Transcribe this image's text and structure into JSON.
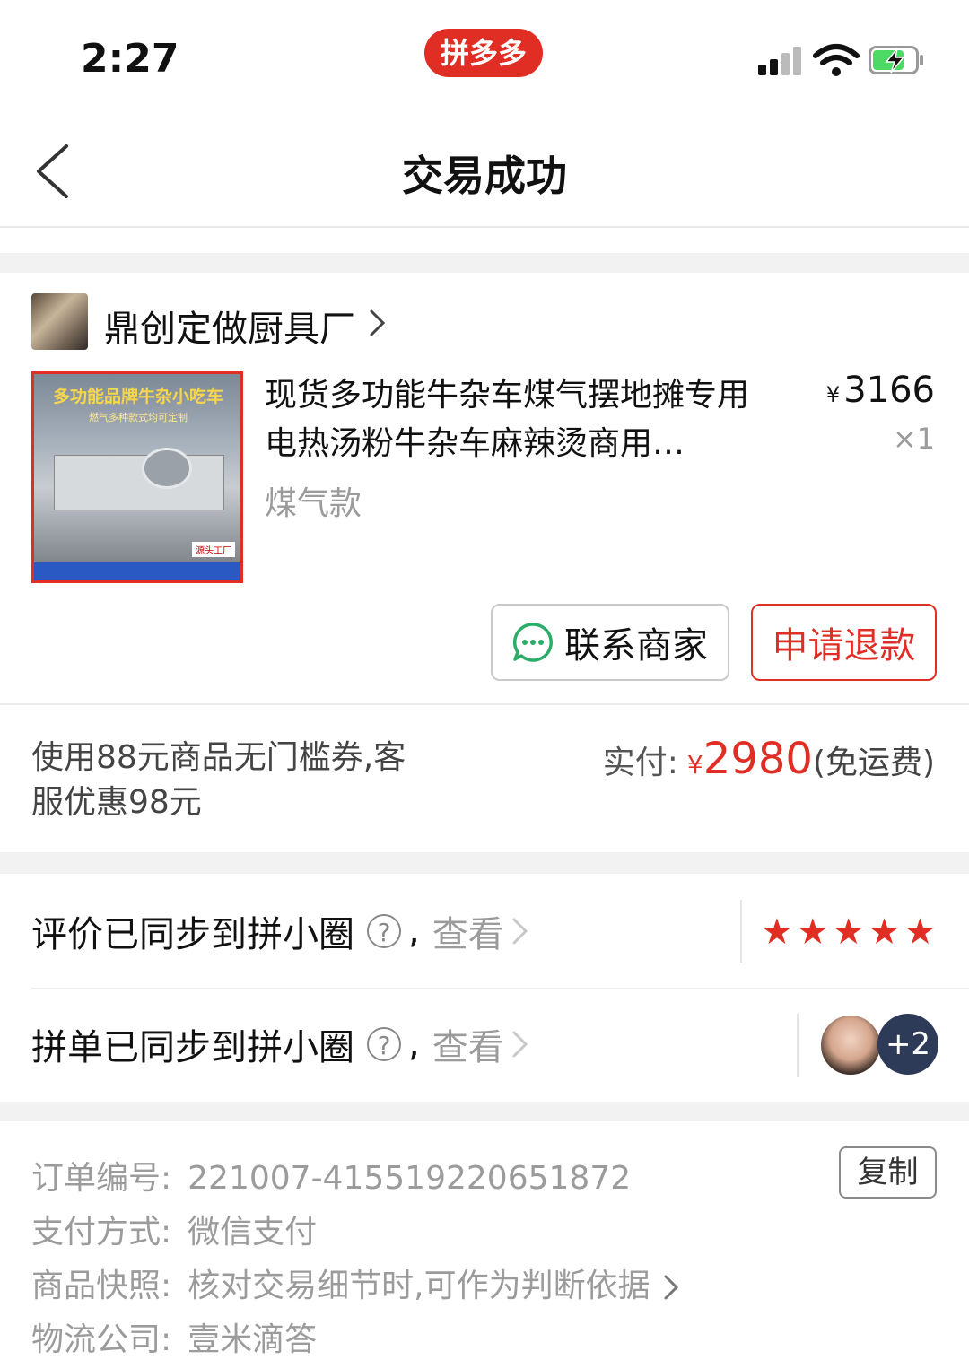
{
  "status_bar": {
    "time": "2:27",
    "app_badge": "拼多多"
  },
  "nav": {
    "title": "交易成功"
  },
  "store": {
    "name": "鼎创定做厨具厂"
  },
  "product": {
    "thumb_title": "多功能品牌牛杂小吃车",
    "thumb_subtitle": "燃气多种款式均可定制",
    "thumb_tag": "源头工厂",
    "title": "现货多功能牛杂车煤气摆地摊专用电热汤粉牛杂车麻辣烫商用…",
    "variant": "煤气款",
    "price_symbol": "¥",
    "price": "3166",
    "quantity": "×1"
  },
  "actions": {
    "contact_label": "联系商家",
    "refund_label": "申请退款"
  },
  "payment": {
    "discount_text": "使用88元商品无门槛券,客服优惠98元",
    "paid_label": "实付:",
    "paid_symbol": "¥",
    "paid_amount": "2980",
    "shipping_note": "(免运费)"
  },
  "sync_rows": {
    "review": {
      "text": "评价已同步到拼小圈",
      "help": "?",
      "comma": ",",
      "view": "查看",
      "stars": "★★★★★",
      "rating": 5
    },
    "group": {
      "text": "拼单已同步到拼小圈",
      "help": "?",
      "comma": ",",
      "view": "查看",
      "extra_count": "+2"
    }
  },
  "order_info": {
    "order_no_label": "订单编号:",
    "order_no": "221007-415519220651872",
    "copy_label": "复制",
    "pay_method_label": "支付方式:",
    "pay_method": "微信支付",
    "snapshot_label": "商品快照:",
    "snapshot": "核对交易细节时,可作为判断依据",
    "logistics_label": "物流公司:",
    "logistics": "壹米滴答"
  },
  "colors": {
    "accent": "#e02e24",
    "muted": "#9b9b9b",
    "wechat_green": "#2aae67"
  }
}
